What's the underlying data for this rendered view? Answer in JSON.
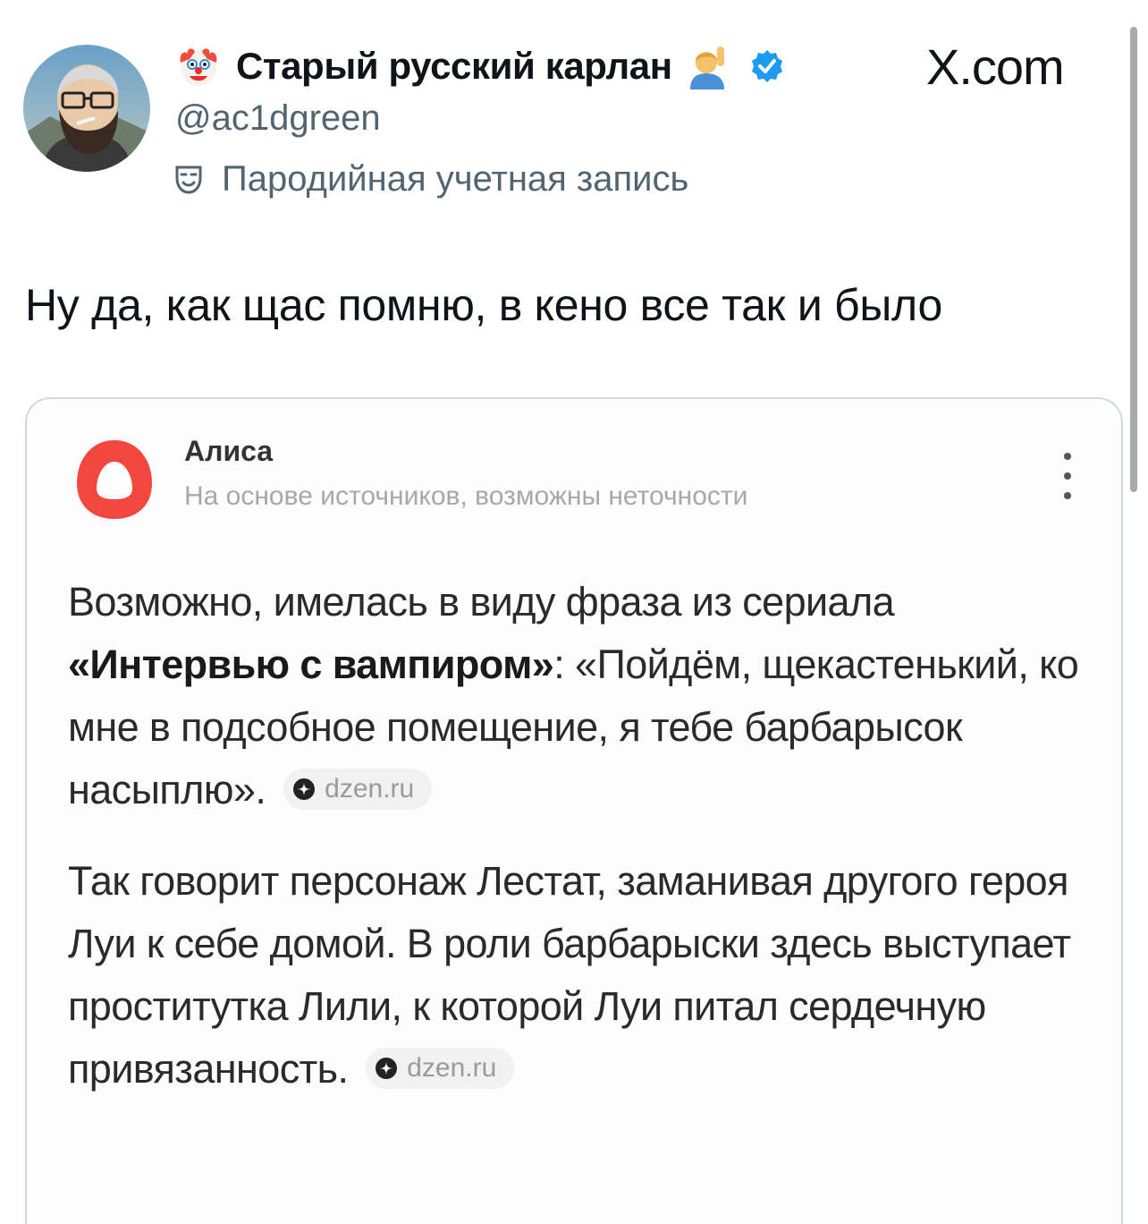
{
  "post": {
    "display_name": "Старый русский карлан",
    "handle": "@ac1dgreen",
    "parody_label": "Пародийная учетная запись",
    "site": "X.com",
    "text": "Ну да, как щас помню, в кено все так и было"
  },
  "alice_card": {
    "name": "Алиса",
    "subtitle": "На основе источников, возможны неточности",
    "para1_intro": "Возможно, имелась в виду фраза из сериала ",
    "para1_title": "«Интервью с вампиром»",
    "para1_quote": ": «Пойдём, щекастенький, ко мне в подсобное помещение, я тебе барбарысок насыплю». ",
    "para1_source": "dzen.ru",
    "para2_text": "Так говорит персонаж Лестат, заманивая другого героя Луи к себе домой. В роли барбарыски здесь выступает проститутка Лили, к которой Луи питал сердечную привязанность. ",
    "para2_source": "dzen.ru"
  },
  "colors": {
    "verified_blue": "#1d9bf0",
    "alice_red": "#f2473f",
    "secondary_text": "#536471"
  }
}
